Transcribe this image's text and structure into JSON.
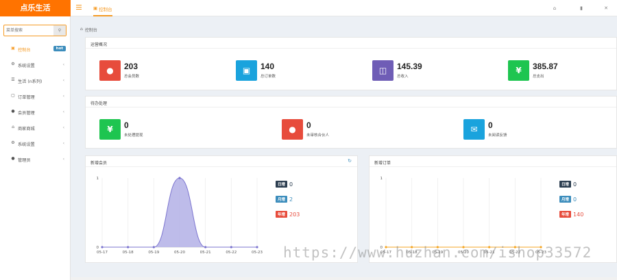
{
  "app": {
    "logo": "点乐生活"
  },
  "topbar": {
    "active_tab": "控制台",
    "icons": [
      "menu-icon",
      "home-icon",
      "trash-icon",
      "expand-icon"
    ]
  },
  "sidebar": {
    "search_placeholder": "菜单搜索",
    "items": [
      {
        "label": "控制台",
        "icon": "monitor-icon",
        "badge": "hot",
        "active": true
      },
      {
        "label": "系统设置",
        "icon": "gear-icon"
      },
      {
        "label": "生活 (n系列)",
        "icon": "list-icon"
      },
      {
        "label": "订单管理",
        "icon": "document-icon"
      },
      {
        "label": "会员管理",
        "icon": "user-icon"
      },
      {
        "label": "商家商城",
        "icon": "home-icon"
      },
      {
        "label": "系统设置",
        "icon": "gear-icon"
      },
      {
        "label": "管理员",
        "icon": "users-icon"
      }
    ]
  },
  "breadcrumb": "控制台",
  "overview": {
    "title": "运营概况",
    "stats": [
      {
        "value": "203",
        "label": "总会员数",
        "color": "#e74c3c",
        "icon": "user-icon"
      },
      {
        "value": "140",
        "label": "总订单数",
        "color": "#1aa3dd",
        "icon": "bag-icon"
      },
      {
        "value": "145.39",
        "label": "总收入",
        "color": "#6f5db6",
        "icon": "money-icon"
      },
      {
        "value": "385.87",
        "label": "总支出",
        "color": "#1ec550",
        "icon": "yen-icon"
      }
    ]
  },
  "pending": {
    "title": "待办处理",
    "stats": [
      {
        "value": "0",
        "label": "未处理提现",
        "color": "#1ec550",
        "icon": "yen-icon"
      },
      {
        "value": "0",
        "label": "未审核合伙人",
        "color": "#e74c3c",
        "icon": "user-icon"
      },
      {
        "value": "0",
        "label": "未阅读反馈",
        "color": "#1aa3dd",
        "icon": "mail-icon"
      }
    ]
  },
  "members_chart_panel": {
    "title": "新增会员",
    "legend": [
      {
        "tag": "日增",
        "value": "0",
        "color": "#2c3e50"
      },
      {
        "tag": "月增",
        "value": "2",
        "color": "#3c8dbc"
      },
      {
        "tag": "年增",
        "value": "203",
        "color": "#e74c3c"
      }
    ]
  },
  "orders_chart_panel": {
    "title": "新增订单",
    "legend": [
      {
        "tag": "日增",
        "value": "0",
        "color": "#2c3e50"
      },
      {
        "tag": "月增",
        "value": "0",
        "color": "#3c8dbc"
      },
      {
        "tag": "年增",
        "value": "140",
        "color": "#e74c3c"
      }
    ]
  },
  "watermark": "https://www.huzhan.com/ishop33572",
  "chart_data": [
    {
      "type": "area",
      "title": "新增会员",
      "x": [
        "05-17",
        "05-18",
        "05-19",
        "05-20",
        "05-21",
        "05-22",
        "05-23"
      ],
      "y": [
        0,
        0,
        0,
        1,
        0,
        0,
        0
      ],
      "ylim": [
        0,
        1
      ],
      "yticks": [
        "0",
        "1"
      ],
      "grid": true,
      "colors": {
        "fill": "#b3b0e6",
        "line": "#7b74cf"
      }
    },
    {
      "type": "line",
      "title": "新增订单",
      "x": [
        "05-17",
        "05-18",
        "05-19",
        "05-20",
        "05-21",
        "05-22",
        "05-23"
      ],
      "y": [
        0,
        0,
        0,
        0,
        0,
        0,
        0
      ],
      "ylim": [
        0,
        1
      ],
      "yticks": [
        "0",
        "1"
      ],
      "grid": true,
      "colors": {
        "line": "#f5a623"
      }
    }
  ]
}
